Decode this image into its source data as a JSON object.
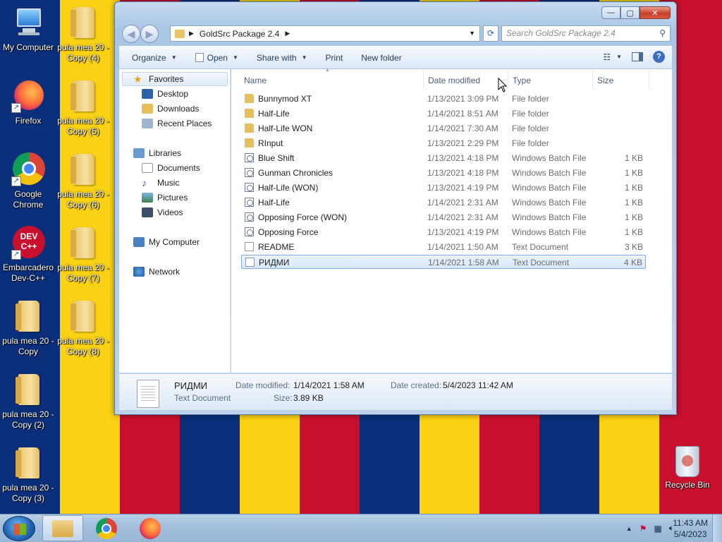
{
  "colors": {
    "flag_blue": "#0b2f7a",
    "flag_yellow": "#fbd114",
    "flag_red": "#c8102e",
    "selection": "#d6e8fb"
  },
  "desktop": {
    "icons": [
      {
        "label": "My Computer",
        "icon": "computer-icon"
      },
      {
        "label": "Firefox",
        "icon": "firefox-icon"
      },
      {
        "label": "Google Chrome",
        "icon": "chrome-icon"
      },
      {
        "label": "Embarcadero Dev-C++",
        "icon": "devcpp-icon"
      },
      {
        "label": "pula mea 20 - Copy",
        "icon": "folder-icon"
      },
      {
        "label": "pula mea 20 - Copy (2)",
        "icon": "folder-icon"
      },
      {
        "label": "pula mea 20 - Copy (3)",
        "icon": "folder-icon"
      },
      {
        "label": "pula mea 20 - Copy (4)",
        "icon": "folder-icon"
      },
      {
        "label": "pula mea 20 - Copy (5)",
        "icon": "folder-icon"
      },
      {
        "label": "pula mea 20 - Copy (6)",
        "icon": "folder-icon"
      },
      {
        "label": "pula mea 20 - Copy (7)",
        "icon": "folder-icon"
      },
      {
        "label": "pula mea 20 - Copy (8)",
        "icon": "folder-icon"
      }
    ],
    "recycle_bin": "Recycle Bin",
    "devcpp_badge": "DEV C++"
  },
  "window": {
    "caption_buttons": {
      "minimize": "—",
      "maximize": "▢",
      "close": "✕"
    },
    "address": {
      "path": "GoldSrc Package 2.4"
    },
    "search": {
      "placeholder": "Search GoldSrc Package 2.4"
    },
    "toolbar": {
      "organize": "Organize",
      "open": "Open",
      "share_with": "Share with",
      "print": "Print",
      "new_folder": "New folder"
    },
    "nav": {
      "favorites": "Favorites",
      "favorites_items": [
        "Desktop",
        "Downloads",
        "Recent Places"
      ],
      "libraries": "Libraries",
      "libraries_items": [
        "Documents",
        "Music",
        "Pictures",
        "Videos"
      ],
      "computer": "My Computer",
      "network": "Network"
    },
    "columns": {
      "name": "Name",
      "date": "Date modified",
      "type": "Type",
      "size": "Size"
    },
    "files": [
      {
        "name": "Bunnymod XT",
        "date": "1/13/2021 3:09 PM",
        "type": "File folder",
        "size": "",
        "kind": "folder"
      },
      {
        "name": "Half-Life",
        "date": "1/14/2021 8:51 AM",
        "type": "File folder",
        "size": "",
        "kind": "folder"
      },
      {
        "name": "Half-Life WON",
        "date": "1/14/2021 7:30 AM",
        "type": "File folder",
        "size": "",
        "kind": "folder"
      },
      {
        "name": "RInput",
        "date": "1/13/2021 2:29 PM",
        "type": "File folder",
        "size": "",
        "kind": "folder"
      },
      {
        "name": "Blue Shift",
        "date": "1/13/2021 4:18 PM",
        "type": "Windows Batch File",
        "size": "1 KB",
        "kind": "bat"
      },
      {
        "name": "Gunman Chronicles",
        "date": "1/13/2021 4:18 PM",
        "type": "Windows Batch File",
        "size": "1 KB",
        "kind": "bat"
      },
      {
        "name": "Half-Life (WON)",
        "date": "1/13/2021 4:19 PM",
        "type": "Windows Batch File",
        "size": "1 KB",
        "kind": "bat"
      },
      {
        "name": "Half-Life",
        "date": "1/14/2021 2:31 AM",
        "type": "Windows Batch File",
        "size": "1 KB",
        "kind": "bat"
      },
      {
        "name": "Opposing Force (WON)",
        "date": "1/14/2021 2:31 AM",
        "type": "Windows Batch File",
        "size": "1 KB",
        "kind": "bat"
      },
      {
        "name": "Opposing Force",
        "date": "1/13/2021 4:19 PM",
        "type": "Windows Batch File",
        "size": "1 KB",
        "kind": "bat"
      },
      {
        "name": "README",
        "date": "1/14/2021 1:50 AM",
        "type": "Text Document",
        "size": "3 KB",
        "kind": "txt"
      },
      {
        "name": "РИДМИ",
        "date": "1/14/2021 1:58 AM",
        "type": "Text Document",
        "size": "4 KB",
        "kind": "txt",
        "selected": true
      }
    ],
    "details": {
      "name": "РИДМИ",
      "type": "Text Document",
      "date_modified_label": "Date modified:",
      "date_modified": "1/14/2021 1:58 AM",
      "date_created_label": "Date created:",
      "date_created": "5/4/2023 11:42 AM",
      "size_label": "Size:",
      "size": "3.89 KB"
    }
  },
  "taskbar": {
    "time": "11:43 AM",
    "date": "5/4/2023"
  }
}
